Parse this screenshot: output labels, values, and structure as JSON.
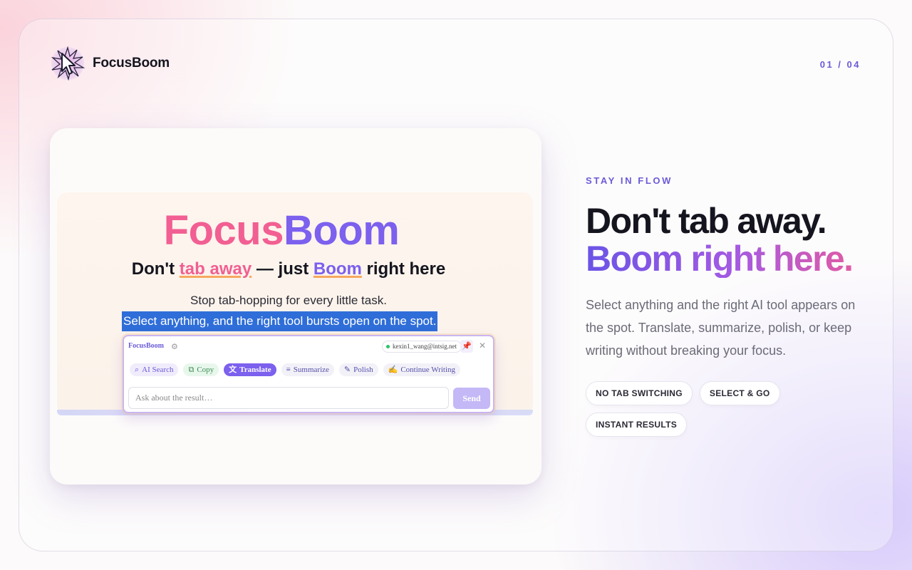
{
  "brand": {
    "name": "FocusBoom"
  },
  "pager": {
    "label": "01 / 04"
  },
  "preview": {
    "title_part1": "Focus",
    "title_part2": "Boom",
    "subtitle": {
      "pre": "Don't ",
      "highlight1": "tab away",
      "mid": " — just ",
      "highlight2": "Boom",
      "post": " right here"
    },
    "line1": "Stop tab-hopping for every little task.",
    "line2_selected": "Select anything, and the right tool bursts open on the spot.",
    "popup": {
      "brand": "FocusBoom",
      "user_email": "kexin1_wang@intsig.net",
      "tools": [
        {
          "label": "AI Search",
          "icon": "search-icon"
        },
        {
          "label": "Copy",
          "icon": "copy-icon"
        },
        {
          "label": "Translate",
          "icon": "translate-icon",
          "active": true
        },
        {
          "label": "Summarize",
          "icon": "list-icon"
        },
        {
          "label": "Polish",
          "icon": "pen-icon"
        },
        {
          "label": "Continue Writing",
          "icon": "write-icon"
        }
      ],
      "input_placeholder": "Ask about the result…",
      "send_label": "Send"
    }
  },
  "hero": {
    "eyebrow": "STAY IN FLOW",
    "headline_line1": "Don't tab away.",
    "headline_line2": "Boom right here.",
    "description": "Select anything and the right AI tool appears on the spot. Translate, summarize, polish, or keep writing without breaking your focus.",
    "tags": [
      "NO TAB SWITCHING",
      "SELECT & GO",
      "INSTANT RESULTS"
    ]
  },
  "colors": {
    "accent": "#6a5bd8",
    "pink": "#f25f92",
    "purple": "#7c60ee",
    "selection": "#2f6ed8"
  }
}
